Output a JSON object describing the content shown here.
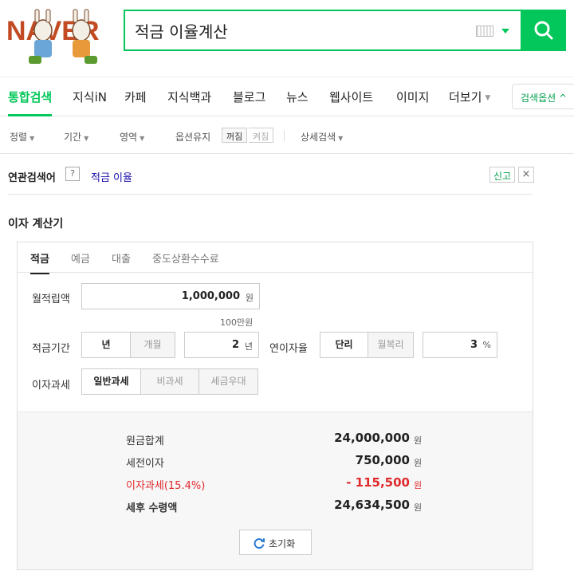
{
  "header": {
    "logo_text": "NAVER",
    "search_value": "적금 이율계산"
  },
  "tabs": [
    {
      "label": "통합검색",
      "active": true
    },
    {
      "label": "지식iN"
    },
    {
      "label": "카페"
    },
    {
      "label": "지식백과"
    },
    {
      "label": "블로그"
    },
    {
      "label": "뉴스"
    },
    {
      "label": "웹사이트"
    },
    {
      "label": "이미지"
    },
    {
      "label": "더보기"
    }
  ],
  "search_options_label": "검색옵션 ^",
  "filters": {
    "sort": "정렬",
    "period": "기간",
    "area": "영역",
    "keep_options": "옵션유지",
    "on": "꺼짐",
    "off": "켜짐",
    "advanced": "상세검색"
  },
  "related": {
    "title": "연관검색어",
    "help": "?",
    "keyword": "적금 이율",
    "report": "신고",
    "close": "×"
  },
  "calculator": {
    "title": "이자 계산기",
    "tabs": [
      "적금",
      "예금",
      "대출",
      "중도상환수수료"
    ],
    "monthly_label": "월적립액",
    "monthly_value": "1,000,000",
    "monthly_unit": "원",
    "monthly_hint": "100만원",
    "period_label": "적금기간",
    "period_opt_year": "년",
    "period_opt_month": "개월",
    "period_value": "2",
    "period_unit": "년",
    "rate_label": "연이자율",
    "rate_opt_simple": "단리",
    "rate_opt_compound": "월복리",
    "rate_value": "3",
    "rate_unit": "%",
    "tax_label": "이자과세",
    "tax_opts": [
      "일반과세",
      "비과세",
      "세금우대"
    ],
    "results": [
      {
        "label": "원금합계",
        "value": "24,000,000",
        "unit": "원"
      },
      {
        "label": "세전이자",
        "value": "750,000",
        "unit": "원"
      },
      {
        "label": "이자과세(15.4%)",
        "value": "- 115,500",
        "unit": "원"
      },
      {
        "label": "세후 수령액",
        "value": "24,634,500",
        "unit": "원"
      }
    ],
    "reset_label": "초기화"
  },
  "colors": {
    "accent": "#03c75a",
    "negative": "#e0292b"
  }
}
